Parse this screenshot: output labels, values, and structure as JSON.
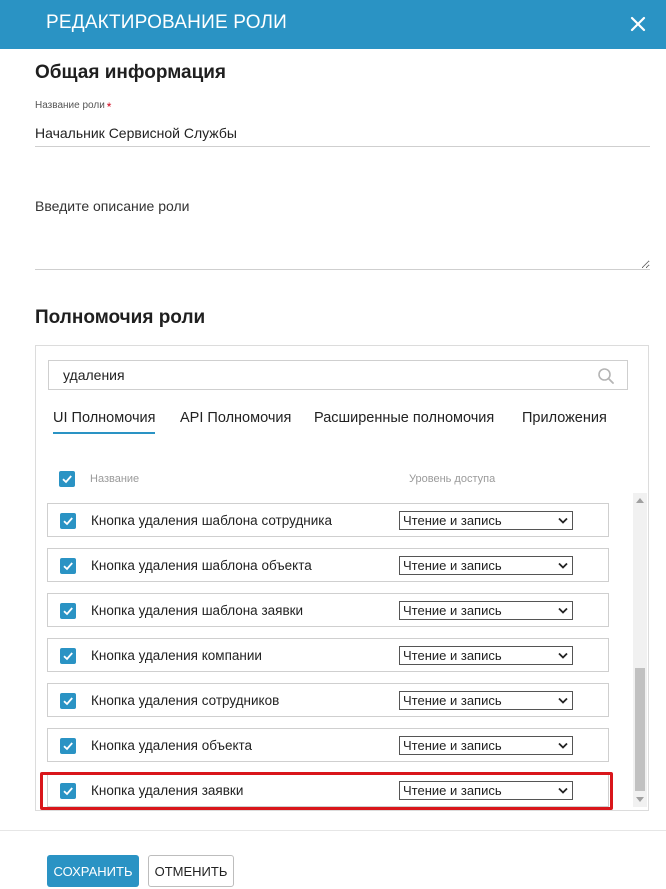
{
  "header": {
    "title": "РЕДАКТИРОВАНИЕ РОЛИ",
    "close_icon": "close-icon"
  },
  "general": {
    "section_title": "Общая информация",
    "role_name_label": "Название роли",
    "required_mark": "*",
    "role_name_value": "Начальник Сервисной Службы",
    "description_placeholder": "Введите описание роли",
    "description_value": ""
  },
  "permissions": {
    "section_title": "Полномочия роли",
    "search_value": "удаления",
    "search_icon": "search-icon",
    "tabs": [
      {
        "label": "UI Полномочия",
        "active": true
      },
      {
        "label": "API Полномочия",
        "active": false
      },
      {
        "label": "Расширенные полномочия",
        "active": false
      },
      {
        "label": "Приложения",
        "active": false
      }
    ],
    "columns": {
      "name": "Название",
      "access": "Уровень доступа"
    },
    "select_all_checked": true,
    "rows": [
      {
        "label": "Кнопка удаления шаблона сотрудника",
        "access": "Чтение и запись",
        "checked": true,
        "highlighted": false
      },
      {
        "label": "Кнопка удаления шаблона объекта",
        "access": "Чтение и запись",
        "checked": true,
        "highlighted": false
      },
      {
        "label": "Кнопка удаления шаблона заявки",
        "access": "Чтение и запись",
        "checked": true,
        "highlighted": false
      },
      {
        "label": "Кнопка удаления компании",
        "access": "Чтение и запись",
        "checked": true,
        "highlighted": false
      },
      {
        "label": "Кнопка удаления сотрудников",
        "access": "Чтение и запись",
        "checked": true,
        "highlighted": false
      },
      {
        "label": "Кнопка удаления объекта",
        "access": "Чтение и запись",
        "checked": true,
        "highlighted": false
      },
      {
        "label": "Кнопка удаления заявки",
        "access": "Чтение и запись",
        "checked": true,
        "highlighted": true
      }
    ]
  },
  "footer": {
    "save_label": "СОХРАНИТЬ",
    "cancel_label": "ОТМЕНИТЬ"
  },
  "colors": {
    "accent": "#2a93c4",
    "highlight": "#d9161b"
  }
}
